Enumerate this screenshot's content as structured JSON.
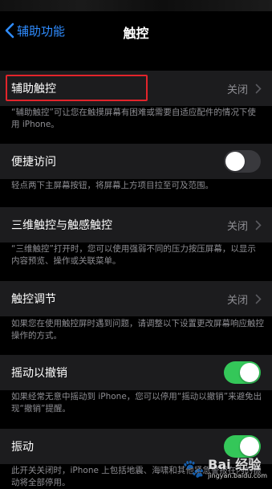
{
  "nav": {
    "back_label": "辅助功能",
    "title": "触控"
  },
  "rows": [
    {
      "label": "辅助触控",
      "value": "关闭",
      "footnote": "“辅助触控”可让您在触摸屏幕有困难或需要自适应配件的情况下使用 iPhone。"
    },
    {
      "label": "便捷访问",
      "toggle": false,
      "footnote": "轻点两下主屏幕按钮，将屏幕上方项目拉至可及范围。"
    },
    {
      "label": "三维触控与触感触控",
      "value": "关闭",
      "footnote": "“三维触控”打开时，您可以使用强弱不同的压力按压屏幕，以显示内容预览、操作或关联菜单。"
    },
    {
      "label": "触控调节",
      "value": "关闭",
      "footnote": "如果您在使用触控屏时遇到问题，请调整以下设置更改屏幕响应触控操作的方式。"
    },
    {
      "label": "摇动以撤销",
      "toggle": true,
      "footnote": "如果经常无意中摇动到 iPhone，您可以停用“摇动以撤销”来避免出现“撤销”提醒。"
    },
    {
      "label": "振动",
      "toggle": true,
      "footnote": "此开关关闭时，iPhone 上包括地震、海啸和其他紧急警报在内的振动将全部停用。"
    }
  ],
  "watermark": {
    "main": "Bai 经验",
    "sub": "jingyan.baidu.com"
  },
  "colors": {
    "background": "#000000",
    "cell": "#1c1c1e",
    "accent_blue": "#2f8cff",
    "toggle_on": "#34c759",
    "toggle_off": "#39393d",
    "secondary_text": "#8e8e93",
    "highlight_red": "#e3242b"
  }
}
